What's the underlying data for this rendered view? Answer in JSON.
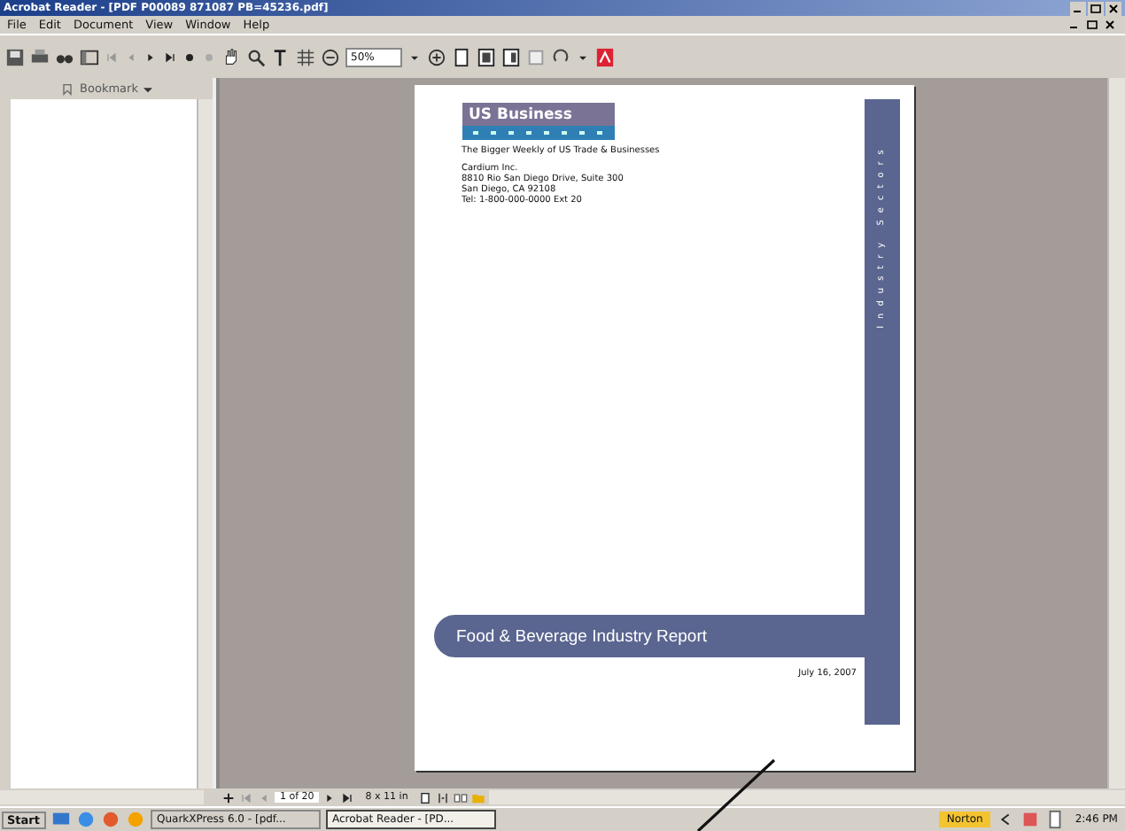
{
  "window": {
    "title": "Acrobat Reader - [PDF P00089 871087 PB=45236.pdf]"
  },
  "menu": [
    "File",
    "Edit",
    "Document",
    "View",
    "Window",
    "Help"
  ],
  "toolbar": {
    "zoom": "50%"
  },
  "sidebar": {
    "tab": "Bookmark"
  },
  "document": {
    "brand": "US Business",
    "tagline": "The Bigger Weekly of US Trade & Businesses",
    "address": [
      "Cardium Inc.",
      "8810 Rio San Diego Drive, Suite 300",
      "San Diego, CA 92108",
      "Tel: 1-800-000-0000 Ext 20"
    ],
    "side_title": "Industry Sectors",
    "title": "Food & Beverage Industry Report",
    "date": "July 16, 2007"
  },
  "navigation": {
    "page": "1 of 20",
    "size": "8 x 11 in"
  },
  "taskbar": {
    "start": "Start",
    "tasks": [
      {
        "label": "QuarkXPress 6.0 - [pdf...",
        "selected": false
      },
      {
        "label": "Acrobat Reader - [PD...",
        "selected": true
      }
    ],
    "norton": "Norton",
    "clock": "2:46 PM"
  }
}
